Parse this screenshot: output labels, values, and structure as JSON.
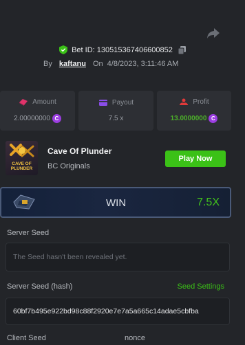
{
  "bet": {
    "id_label": "Bet ID: 130515367406600852",
    "by_label": "By",
    "username": "kaftanu",
    "on_label": "On",
    "datetime": "4/8/2023, 3:11:46 AM"
  },
  "stats": {
    "amount": {
      "label": "Amount",
      "value": "2.00000000",
      "icon": "coins-icon"
    },
    "payout": {
      "label": "Payout",
      "value": "7.5 x",
      "icon": "wallet-icon"
    },
    "profit": {
      "label": "Profit",
      "value": "13.0000000",
      "icon": "profit-icon"
    },
    "coin_symbol": "C"
  },
  "game": {
    "title": "Cave Of Plunder",
    "provider": "BC Originals",
    "thumb_text_line1": "CAVE OF",
    "thumb_text_line2": "PLUNDER",
    "play_label": "Play Now"
  },
  "result": {
    "label": "WIN",
    "multiplier": "7.5X"
  },
  "seeds": {
    "server_seed_label": "Server Seed",
    "server_seed_value": "The Seed hasn't been revealed yet.",
    "server_hash_label": "Server Seed (hash)",
    "seed_settings_label": "Seed Settings",
    "server_hash_value": "60bf7b495e922bd98c88f2920e7e7a5a665c14adae5cbfba",
    "client_seed_label": "Client Seed",
    "nonce_label": "nonce"
  },
  "colors": {
    "background": "#232529",
    "accent_green": "#3bc117",
    "coin_purple": "#9b3de0",
    "amount_icon": "#e0336a",
    "payout_icon": "#8a4de8",
    "profit_icon": "#e03a3a"
  }
}
